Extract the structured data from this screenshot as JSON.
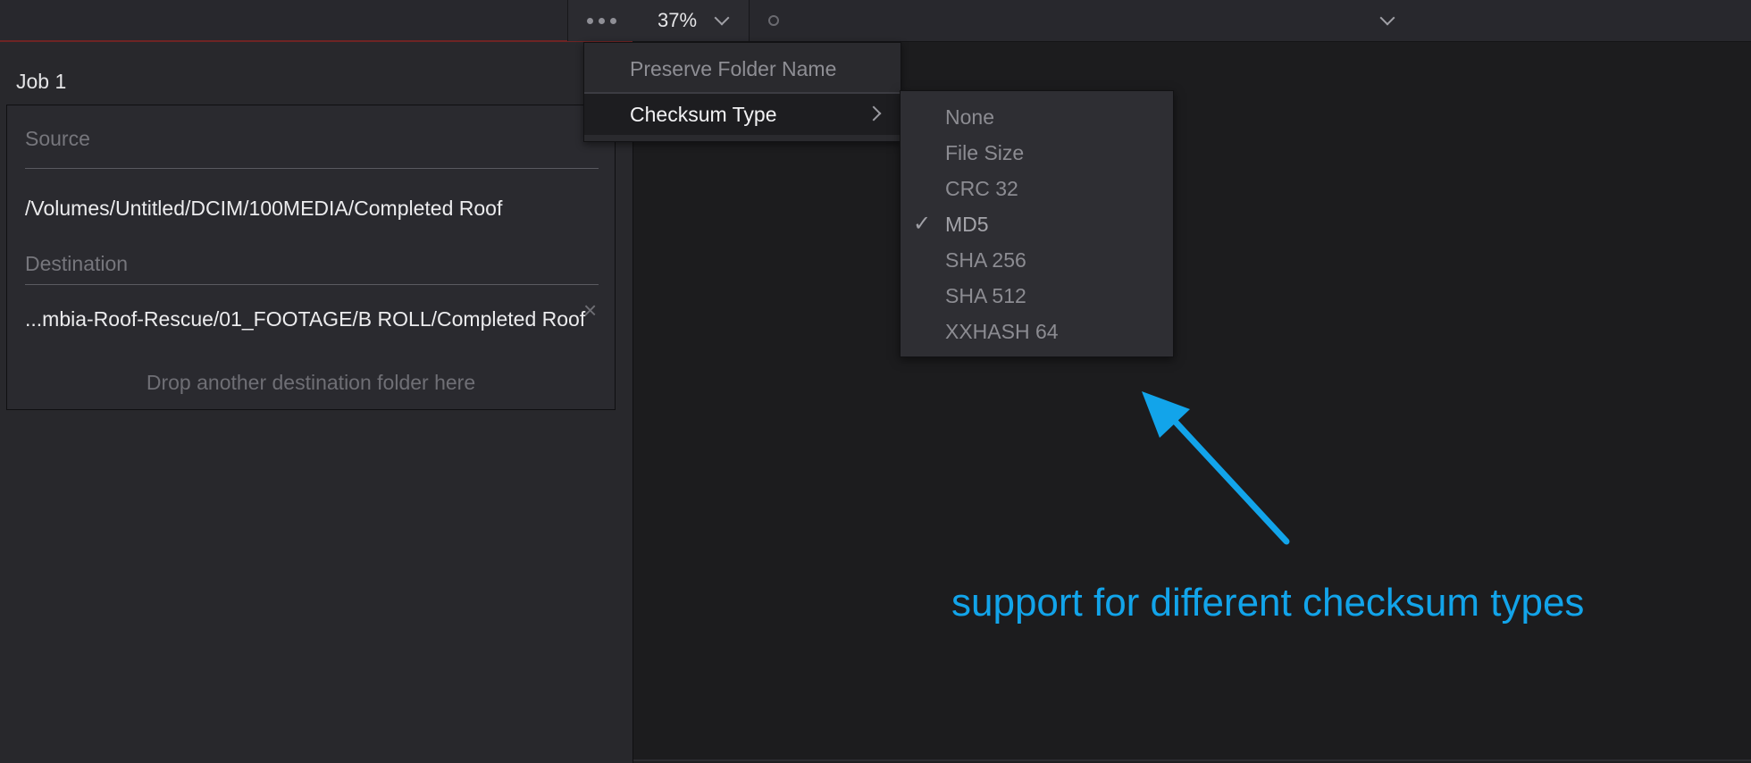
{
  "toolbar": {
    "zoom_value": "37%",
    "more_icon": "more-horizontal-icon",
    "colors": {
      "topbar": "#28282d",
      "accent_line": "#6e2424"
    }
  },
  "job": {
    "title": "Job 1",
    "source_label": "Source",
    "source_path": "/Volumes/Untitled/DCIM/100MEDIA/Completed Roof",
    "destination_label": "Destination",
    "destination_path": "...mbia-Roof-Rescue/01_FOOTAGE/B ROLL/Completed Roof",
    "remove_glyph": "×",
    "drop_hint": "Drop another destination folder here"
  },
  "options_menu": {
    "items": [
      {
        "label": "Preserve Folder Name"
      },
      {
        "label": "Checksum Type",
        "has_submenu": true
      }
    ]
  },
  "checksum_menu": {
    "selected": "MD5",
    "check_glyph": "✓",
    "options": [
      "None",
      "File Size",
      "CRC 32",
      "MD5",
      "SHA 256",
      "SHA 512",
      "XXHASH 64"
    ]
  },
  "callout": {
    "text": "support for different checksum types",
    "color": "#12a4ea"
  }
}
